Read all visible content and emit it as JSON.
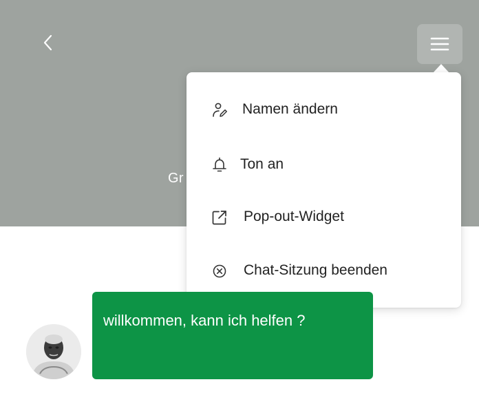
{
  "header": {
    "title": "Gr",
    "background": "#9ea39f",
    "back_icon": "chevron-left-icon",
    "menu_icon": "hamburger-menu-icon"
  },
  "menu": {
    "items": [
      {
        "label": "Namen ändern",
        "icon": "user-edit-icon"
      },
      {
        "label": "Ton an",
        "icon": "bell-icon"
      },
      {
        "label": "Pop-out-Widget",
        "icon": "external-link-icon"
      },
      {
        "label": "Chat-Sitzung beenden",
        "icon": "close-circle-icon"
      }
    ]
  },
  "chat": {
    "messages": [
      {
        "text": "willkommen, kann ich helfen ?",
        "sender": "agent"
      }
    ],
    "bubble_color": "#0d9446"
  }
}
